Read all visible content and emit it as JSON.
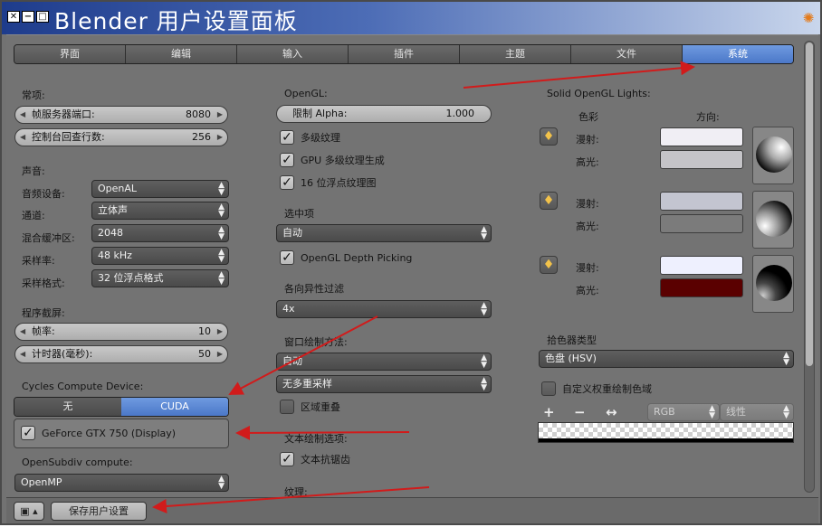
{
  "window": {
    "title": "Blender 用户设置面板"
  },
  "tabs": [
    {
      "label": "界面",
      "active": false
    },
    {
      "label": "编辑",
      "active": false
    },
    {
      "label": "输入",
      "active": false
    },
    {
      "label": "插件",
      "active": false
    },
    {
      "label": "主题",
      "active": false
    },
    {
      "label": "文件",
      "active": false
    },
    {
      "label": "系统",
      "active": true
    }
  ],
  "general": {
    "header": "常项:",
    "frameserver": {
      "label": "帧服务器端口:",
      "value": "8080"
    },
    "console": {
      "label": "控制台回查行数:",
      "value": "256"
    }
  },
  "sound": {
    "header": "声音:",
    "device": {
      "label": "音频设备:",
      "value": "OpenAL"
    },
    "channels": {
      "label": "通道:",
      "value": "立体声"
    },
    "buffer": {
      "label": "混合缓冲区:",
      "value": "2048"
    },
    "rate": {
      "label": "采样率:",
      "value": "48 kHz"
    },
    "format": {
      "label": "采样格式:",
      "value": "32 位浮点格式"
    }
  },
  "screencast": {
    "header": "程序截屏:",
    "fps": {
      "label": "帧率:",
      "value": "10"
    },
    "timer": {
      "label": "计时器(毫秒):",
      "value": "50"
    }
  },
  "cycles": {
    "header": "Cycles Compute Device:",
    "options": [
      {
        "label": "无",
        "active": false
      },
      {
        "label": "CUDA",
        "active": true
      }
    ],
    "device": "GeForce GTX 750 (Display)"
  },
  "opensubdiv": {
    "header": "OpenSubdiv compute:",
    "value": "OpenMP"
  },
  "opengl": {
    "header": "OpenGL:",
    "alpha": {
      "label": "限制 Alpha:",
      "value": "1.000"
    },
    "mipmaps": "多级纹理",
    "gpu_mipmap": "GPU 多级纹理生成",
    "float16": "16 位浮点纹理图"
  },
  "selection": {
    "header": "选中项",
    "value": "自动",
    "depth_picking": "OpenGL Depth Picking"
  },
  "anisotropic": {
    "header": "各向异性过滤",
    "value": "4x"
  },
  "window_draw": {
    "header": "窗口绘制方法:",
    "method": "自动",
    "multisample": "无多重采样",
    "region_overlap": "区域重叠"
  },
  "text_draw": {
    "header": "文本绘制选项:",
    "antialias": "文本抗锯齿"
  },
  "textures": {
    "header": "纹理:"
  },
  "lights": {
    "header": "Solid OpenGL Lights:",
    "col_color": "色彩",
    "col_direction": "方向:",
    "diffuse": "漫射:",
    "specular": "高光:",
    "colors": {
      "light1_diffuse": "#f0eef4",
      "light1_specular": "#c5c4c8",
      "light2_diffuse": "#c3c5d0",
      "light2_specular": "#7b7b7b",
      "light3_diffuse": "#eef0fe",
      "light3_specular": "#5a0000"
    }
  },
  "color_picker": {
    "header": "拾色器类型",
    "value": "色盘 (HSV)"
  },
  "custom_weight": {
    "label": "自定义权重绘制色域"
  },
  "ramp": {
    "add": "+",
    "remove": "−",
    "flip": "↔",
    "mode": "RGB",
    "interp": "线性"
  },
  "footer": {
    "save": "保存用户设置"
  },
  "accent": "#5a86d4"
}
